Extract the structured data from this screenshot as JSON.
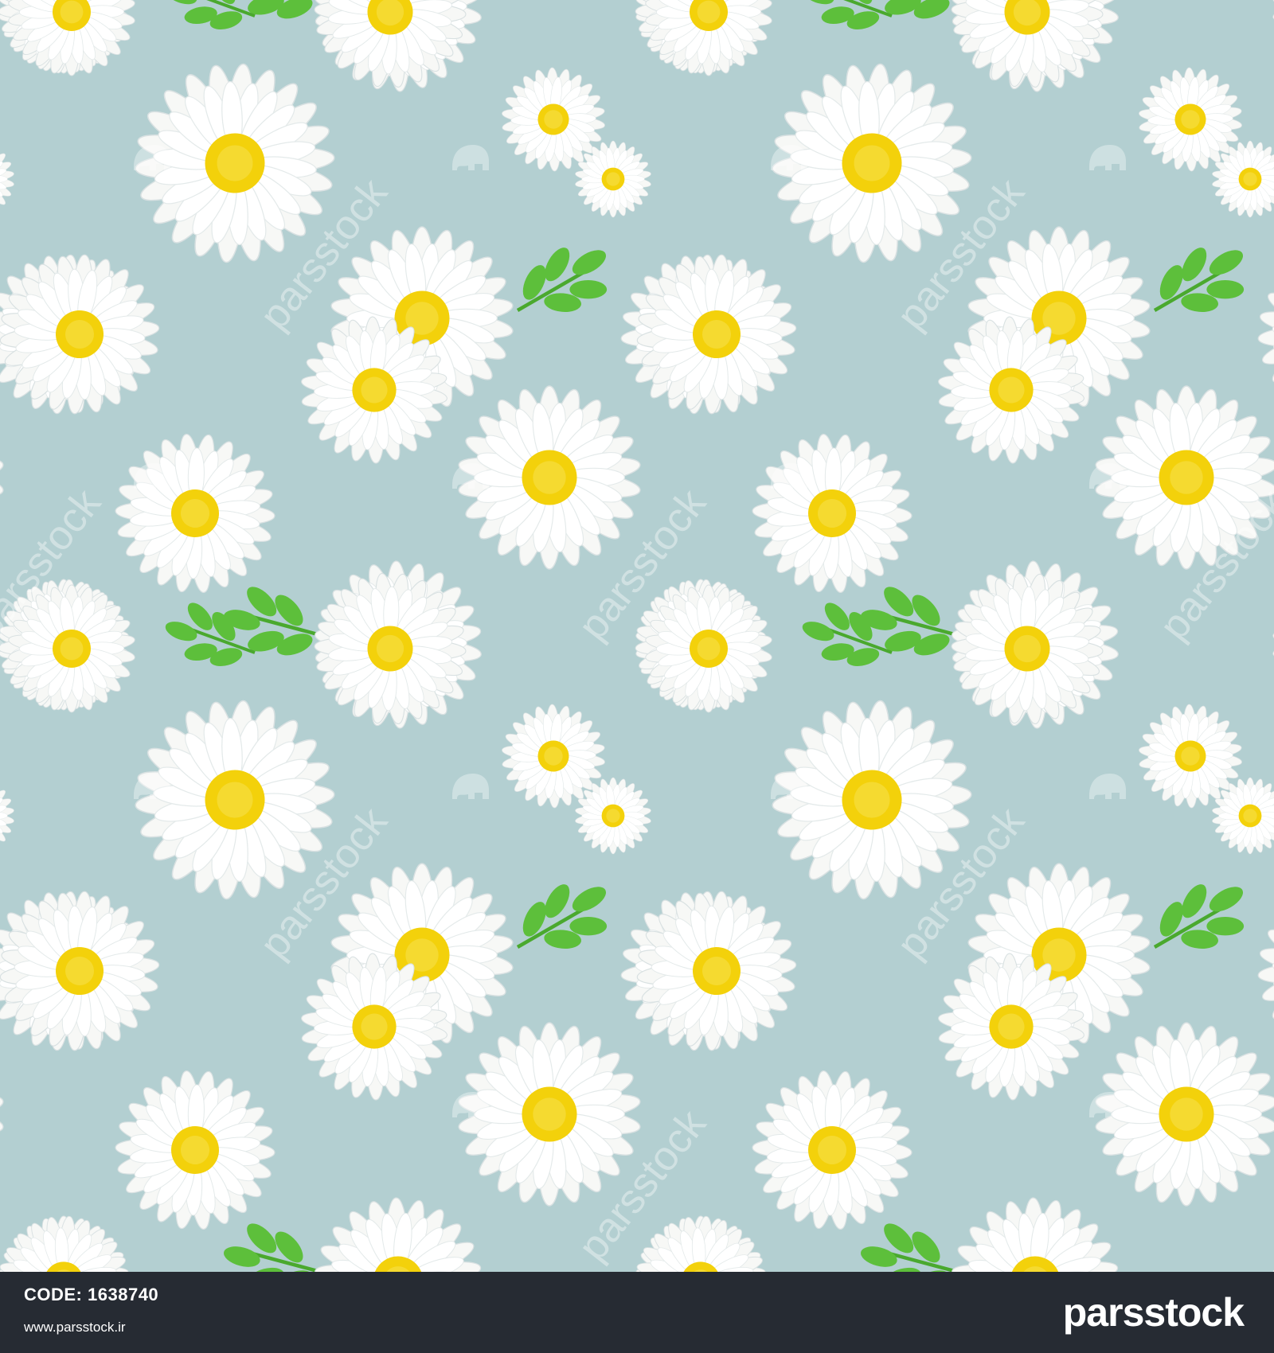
{
  "image": {
    "background_color": "#b3cfd1",
    "petal_color": "#f7f8f6",
    "center_color": "#f3d10b",
    "leaf_color": "#5dbf3b",
    "description_hidden": true
  },
  "watermark": {
    "text": "parsstock",
    "icon": "elephant-logo-icon"
  },
  "footer": {
    "background_color": "#262b33",
    "code_label": "CODE:",
    "code_value": "1638740",
    "url": "www.parsstock.ir",
    "brand": "parsstock"
  }
}
